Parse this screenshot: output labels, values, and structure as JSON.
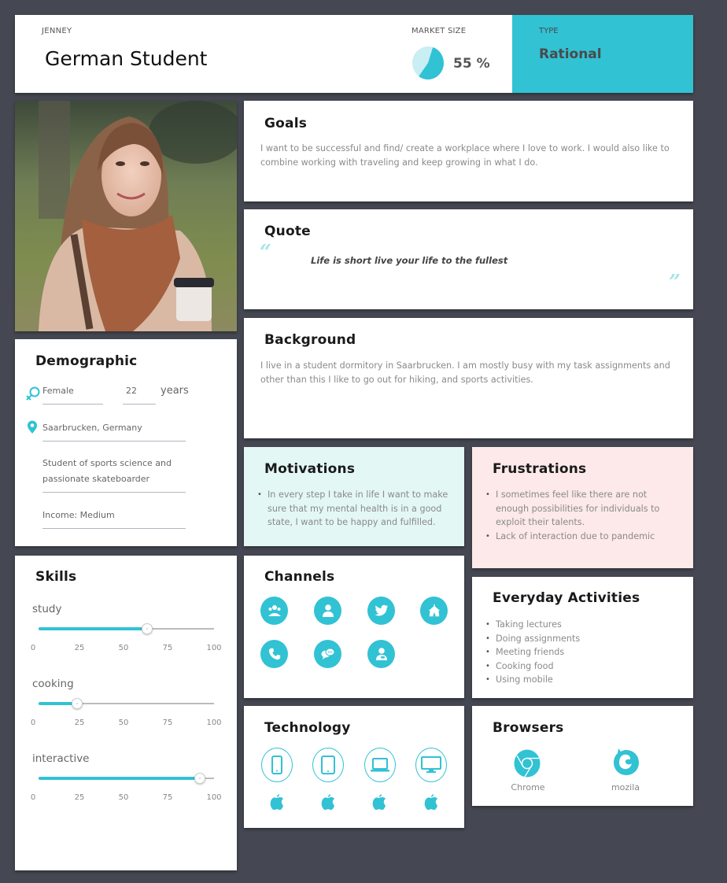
{
  "header": {
    "persona_name": "JENNEY",
    "persona_title": "German Student",
    "market_size_label": "MARKET SIZE",
    "market_size_value": "55 %",
    "market_size_percent": 55,
    "type_label": "TYPE",
    "type_value": "Rational"
  },
  "photo": {
    "alt": "Portrait of a smiling young woman with a scarf holding a coffee cup"
  },
  "demographic": {
    "title": "Demographic",
    "gender": "Female",
    "age": "22",
    "age_unit": "years",
    "location": "Saarbrucken, Germany",
    "occupation": "Student of sports science and passionate skateboarder",
    "income": "Income: Medium"
  },
  "goals": {
    "title": "Goals",
    "text": "I want to be successful and find/ create a workplace where I love to work. I would also like to combine working with traveling and keep growing in what I do."
  },
  "quote": {
    "title": "Quote",
    "text": "Life is short live your life to the fullest",
    "open_mark": "“",
    "close_mark": "”"
  },
  "background": {
    "title": "Background",
    "text": "I live in a student dormitory in Saarbrucken. I am mostly busy with my task assignments and other than this I like to go out for hiking, and sports activities."
  },
  "motivations": {
    "title": "Motivations",
    "items": [
      "In every step I take in life I want to make sure that my mental health is in a good state, I want to be happy and fulfilled."
    ]
  },
  "frustrations": {
    "title": "Frustrations",
    "items": [
      "I sometimes feel like there are not enough possibilities for individuals to exploit their talents.",
      "Lack of interaction due to pandemic"
    ]
  },
  "skills": {
    "title": "Skills",
    "scale_ticks": [
      "0",
      "25",
      "50",
      "75",
      "100"
    ],
    "items": [
      {
        "label": "study",
        "value": 62
      },
      {
        "label": "cooking",
        "value": 22
      },
      {
        "label": "interactive",
        "value": 92
      }
    ]
  },
  "channels": {
    "title": "Channels",
    "icons": [
      "group-meeting-icon",
      "person-icon",
      "twitter-icon",
      "event-tent-icon",
      "phone-icon",
      "chat-bubbles-icon",
      "support-agent-icon"
    ]
  },
  "activities": {
    "title": "Everyday Activities",
    "items": [
      "Taking lectures",
      "Doing assignments",
      "Meeting friends",
      "Cooking food",
      "Using mobile"
    ]
  },
  "technology": {
    "title": "Technology",
    "devices": [
      "smartphone-icon",
      "tablet-icon",
      "laptop-icon",
      "desktop-monitor-icon"
    ],
    "platform": "apple-icon"
  },
  "browsers": {
    "title": "Browsers",
    "items": [
      {
        "name": "Chrome",
        "icon": "chrome-icon"
      },
      {
        "name": "mozila",
        "icon": "firefox-icon"
      }
    ]
  },
  "colors": {
    "accent": "#31c2d4",
    "background": "#454852",
    "motivations_bg": "#e3f7f4",
    "frustrations_bg": "#fde9e9"
  }
}
